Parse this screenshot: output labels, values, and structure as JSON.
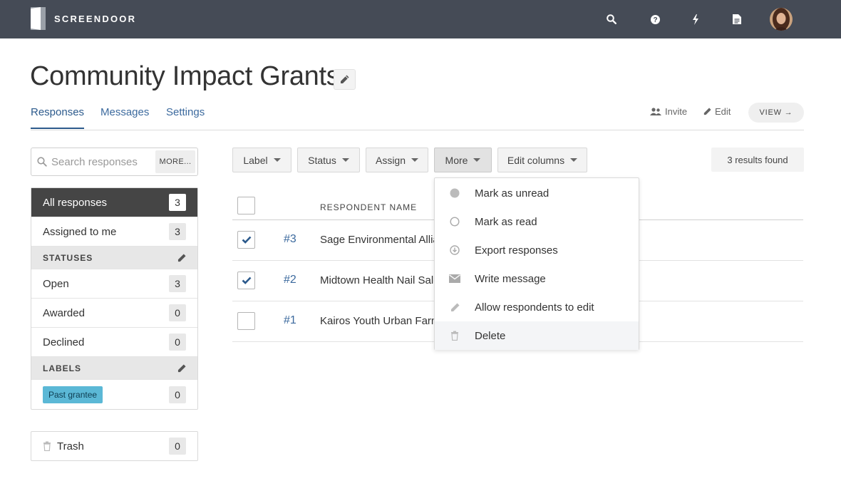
{
  "app": {
    "name": "SCREENDOOR"
  },
  "topbar": {
    "icons": [
      "search-icon",
      "help-icon",
      "lightning-icon",
      "document-icon"
    ]
  },
  "page": {
    "title": "Community Impact Grants"
  },
  "tabs": [
    {
      "label": "Responses",
      "active": true
    },
    {
      "label": "Messages",
      "active": false
    },
    {
      "label": "Settings",
      "active": false
    }
  ],
  "header_actions": {
    "invite": "Invite",
    "edit": "Edit",
    "view": "VIEW →"
  },
  "search": {
    "placeholder": "Search responses",
    "more": "MORE..."
  },
  "sidebar": {
    "all": {
      "label": "All responses",
      "count": "3"
    },
    "assigned": {
      "label": "Assigned to me",
      "count": "3"
    },
    "statuses_title": "STATUSES",
    "statuses": [
      {
        "label": "Open",
        "count": "3"
      },
      {
        "label": "Awarded",
        "count": "0"
      },
      {
        "label": "Declined",
        "count": "0"
      }
    ],
    "labels_title": "LABELS",
    "labels": [
      {
        "label": "Past grantee",
        "count": "0",
        "color": "#5bb8d6"
      }
    ],
    "trash": {
      "label": "Trash",
      "count": "0"
    }
  },
  "toolbar": {
    "label": "Label",
    "status": "Status",
    "assign": "Assign",
    "more": "More",
    "edit_columns": "Edit columns",
    "results": "3 results found"
  },
  "table": {
    "column_header": "RESPONDENT NAME",
    "rows": [
      {
        "id": "#3",
        "name": "Sage Environmental Alliance",
        "checked": true
      },
      {
        "id": "#2",
        "name": "Midtown Health Nail Salon",
        "checked": true
      },
      {
        "id": "#1",
        "name": "Kairos Youth Urban Farm",
        "checked": false
      }
    ]
  },
  "more_menu": {
    "items": [
      {
        "label": "Mark as unread",
        "icon": "filled-circle-icon"
      },
      {
        "label": "Mark as read",
        "icon": "empty-circle-icon"
      },
      {
        "label": "Export responses",
        "icon": "download-icon"
      },
      {
        "label": "Write message",
        "icon": "envelope-icon"
      },
      {
        "label": "Allow respondents to edit",
        "icon": "pencil-icon"
      },
      {
        "label": "Delete",
        "icon": "trash-icon"
      }
    ]
  },
  "colors": {
    "topbar": "#454b56",
    "link": "#3c6a9e",
    "active_row": "#454545",
    "label_chip": "#5bb8d6"
  }
}
